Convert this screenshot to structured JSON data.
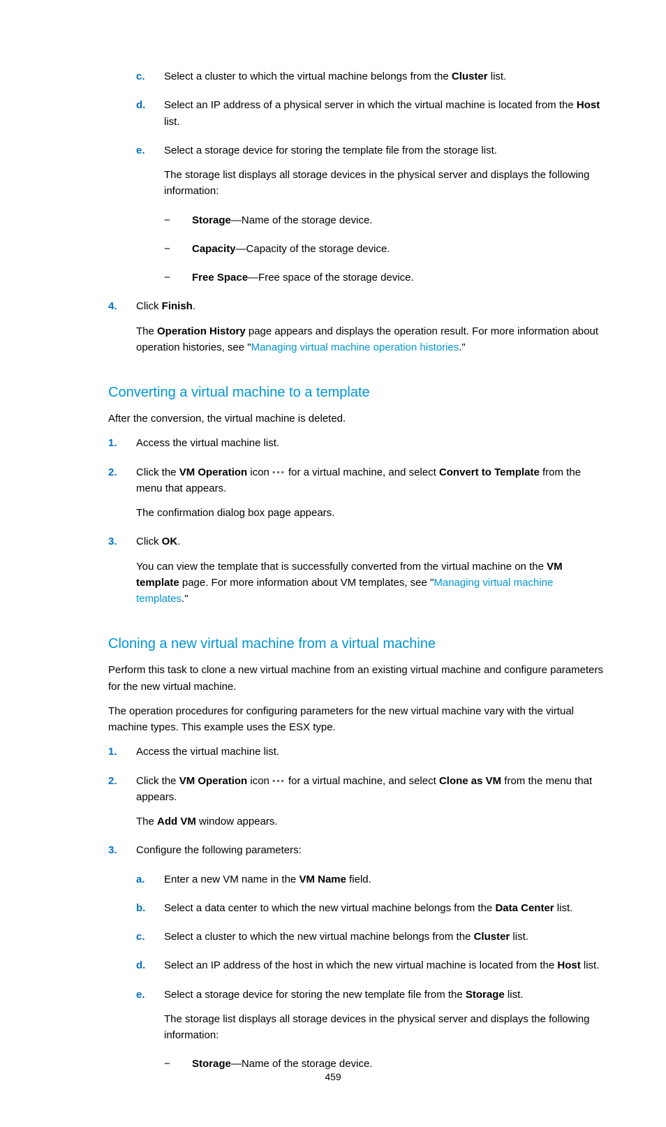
{
  "step_c": {
    "pre": "Select a cluster to which the virtual machine belongs from the ",
    "b1": "Cluster",
    "post": " list."
  },
  "step_d": {
    "pre": "Select an IP address of a physical server in which the virtual machine is located from the ",
    "b1": "Host",
    "post": " list."
  },
  "step_e": {
    "line": "Select a storage device for storing the template file from the storage list.",
    "desc": "The storage list displays all storage devices in the physical server and displays the following information:",
    "bullets": [
      {
        "b": "Storage",
        "t": "—Name of the storage device."
      },
      {
        "b": "Capacity",
        "t": "—Capacity of the storage device."
      },
      {
        "b": "Free Space",
        "t": "—Free space of the storage device."
      }
    ]
  },
  "step4": {
    "line_pre": "Click ",
    "line_b": "Finish",
    "line_post": ".",
    "desc_pre": "The ",
    "desc_b": "Operation History",
    "desc_mid": " page appears and displays the operation result. For more information about operation histories, see \"",
    "desc_link": "Managing virtual machine operation histories",
    "desc_post": ".\""
  },
  "sec1": {
    "title": "Converting a virtual machine to a template",
    "intro": "After the conversion, the virtual machine is deleted.",
    "s1": "Access the virtual machine list.",
    "s2_pre": "Click the ",
    "s2_b1": "VM Operation",
    "s2_mid1": " icon ",
    "s2_mid2": " for a virtual machine, and select ",
    "s2_b2": "Convert to Template",
    "s2_post": " from the menu that appears.",
    "s2_desc": "The confirmation dialog box page appears.",
    "s3_pre": "Click ",
    "s3_b": "OK",
    "s3_post": ".",
    "s3_desc_pre": "You can view the template that is successfully converted from the virtual machine on the ",
    "s3_desc_b": "VM template",
    "s3_desc_mid": " page. For more information about VM templates, see \"",
    "s3_desc_link": "Managing virtual machine templates",
    "s3_desc_post": ".\""
  },
  "sec2": {
    "title": "Cloning a new virtual machine from a virtual machine",
    "intro1": "Perform this task to clone a new virtual machine from an existing virtual machine and configure parameters for the new virtual machine.",
    "intro2": "The operation procedures for configuring parameters for the new virtual machine vary with the virtual machine types. This example uses the ESX type.",
    "s1": "Access the virtual machine list.",
    "s2_pre": "Click the ",
    "s2_b1": "VM Operation",
    "s2_mid1": " icon ",
    "s2_mid2": " for a virtual machine, and select ",
    "s2_b2": "Clone as VM",
    "s2_post": " from the menu that appears.",
    "s2_desc_pre": "The ",
    "s2_desc_b": "Add VM",
    "s2_desc_post": " window appears.",
    "s3": "Configure the following parameters:",
    "a_pre": "Enter a new VM name in the ",
    "a_b": "VM Name",
    "a_post": " field.",
    "b_pre": "Select a data center to which the new virtual machine belongs from the ",
    "b_b": "Data Center",
    "b_post": " list.",
    "c_pre": "Select a cluster to which the new virtual machine belongs from the ",
    "c_b": "Cluster",
    "c_post": " list.",
    "d_pre": "Select an IP address of the host in which the new virtual machine is located from the ",
    "d_b": "Host",
    "d_post": " list.",
    "e_pre": "Select a storage device for storing the new template file from the ",
    "e_b": "Storage",
    "e_post": " list.",
    "e_desc": "The storage list displays all storage devices in the physical server and displays the following information:",
    "e_bullet_b": "Storage",
    "e_bullet_t": "—Name of the storage device."
  },
  "markers": {
    "c": "c.",
    "d": "d.",
    "e": "e.",
    "a": "a.",
    "b": "b.",
    "n1": "1.",
    "n2": "2.",
    "n3": "3.",
    "n4": "4.",
    "dash": "−"
  },
  "pageNumber": "459"
}
